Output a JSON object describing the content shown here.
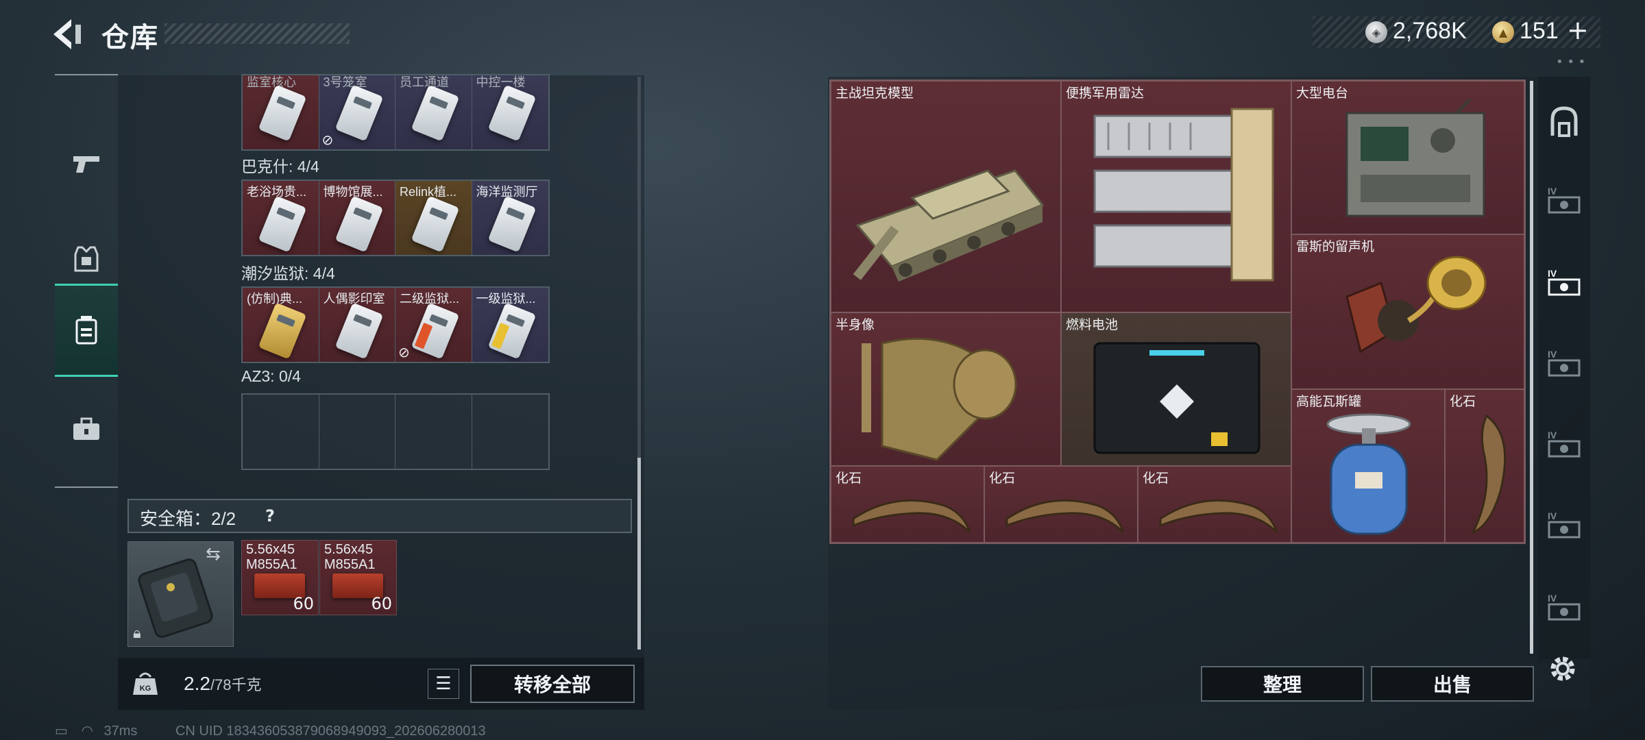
{
  "header": {
    "title": "仓库",
    "currency_silver": "2,768K",
    "currency_gold": "151",
    "plus_label": "+"
  },
  "left_panel": {
    "partial_row": {
      "cards": [
        {
          "label": "监室核心",
          "color": "red",
          "no_drop": false
        },
        {
          "label": "3号笼室",
          "color": "blue",
          "no_drop": true
        },
        {
          "label": "员工通道",
          "color": "blue",
          "no_drop": false
        },
        {
          "label": "中控一楼",
          "color": "blue",
          "no_drop": false
        }
      ]
    },
    "sections": [
      {
        "title": "巴克什: 4/4",
        "cards": [
          {
            "label": "老浴场贵...",
            "color": "red",
            "no_drop": false
          },
          {
            "label": "博物馆展...",
            "color": "red",
            "no_drop": false
          },
          {
            "label": "Relink植...",
            "color": "gold",
            "no_drop": false
          },
          {
            "label": "海洋监测厅",
            "color": "blue",
            "no_drop": false
          }
        ]
      },
      {
        "title": "潮汐监狱: 4/4",
        "cards": [
          {
            "label": "(仿制)典...",
            "color": "red",
            "no_drop": false
          },
          {
            "label": "人偶影印室",
            "color": "red",
            "no_drop": false
          },
          {
            "label": "二级监狱...",
            "color": "red",
            "no_drop": true
          },
          {
            "label": "一级监狱...",
            "color": "blue",
            "no_drop": false
          }
        ]
      },
      {
        "title": "AZ3: 0/4",
        "cards": []
      }
    ],
    "safe_box": {
      "label": "安全箱：2/2",
      "help": "?",
      "ammo": [
        {
          "label_line1": "5.56x45",
          "label_line2": "M855A1",
          "count": "60"
        },
        {
          "label_line1": "5.56x45",
          "label_line2": "M855A1",
          "count": "60"
        }
      ]
    },
    "footer": {
      "weight_value": "2.2",
      "weight_capacity": "/78千克",
      "transfer_all": "转移全部"
    },
    "status": {
      "ping": "37ms",
      "uid": "CN UID 183436053879068949093_202606280013"
    }
  },
  "right_panel": {
    "items": [
      {
        "id": "tank",
        "label": "主战坦克模型"
      },
      {
        "id": "radar",
        "label": "便携军用雷达"
      },
      {
        "id": "radio",
        "label": "大型电台"
      },
      {
        "id": "phonograph",
        "label": "雷斯的留声机"
      },
      {
        "id": "bust",
        "label": "半身像"
      },
      {
        "id": "fuelcell",
        "label": "燃料电池"
      },
      {
        "id": "gascan",
        "label": "高能瓦斯罐"
      },
      {
        "id": "fossil1",
        "label": "化石"
      },
      {
        "id": "fossil2",
        "label": "化石"
      },
      {
        "id": "fossil3",
        "label": "化石"
      },
      {
        "id": "fossil4",
        "label": "化石"
      }
    ],
    "sort_label": "整理",
    "sell_label": "出售",
    "tabs": [
      {
        "icon": "backpack-icon",
        "active": false
      },
      {
        "icon": "case-iv-icon",
        "label": "IV",
        "active": false
      },
      {
        "icon": "case-iv-icon",
        "label": "IV",
        "active": true
      },
      {
        "icon": "case-iv-icon",
        "label": "IV",
        "active": false
      },
      {
        "icon": "case-iv-icon",
        "label": "IV",
        "active": false
      },
      {
        "icon": "case-iv-icon",
        "label": "IV",
        "active": false
      },
      {
        "icon": "case-iv-icon",
        "label": "IV",
        "active": false
      }
    ]
  },
  "colors": {
    "accent": "#3fd0b4",
    "item_bg": "#4b2a2f"
  }
}
